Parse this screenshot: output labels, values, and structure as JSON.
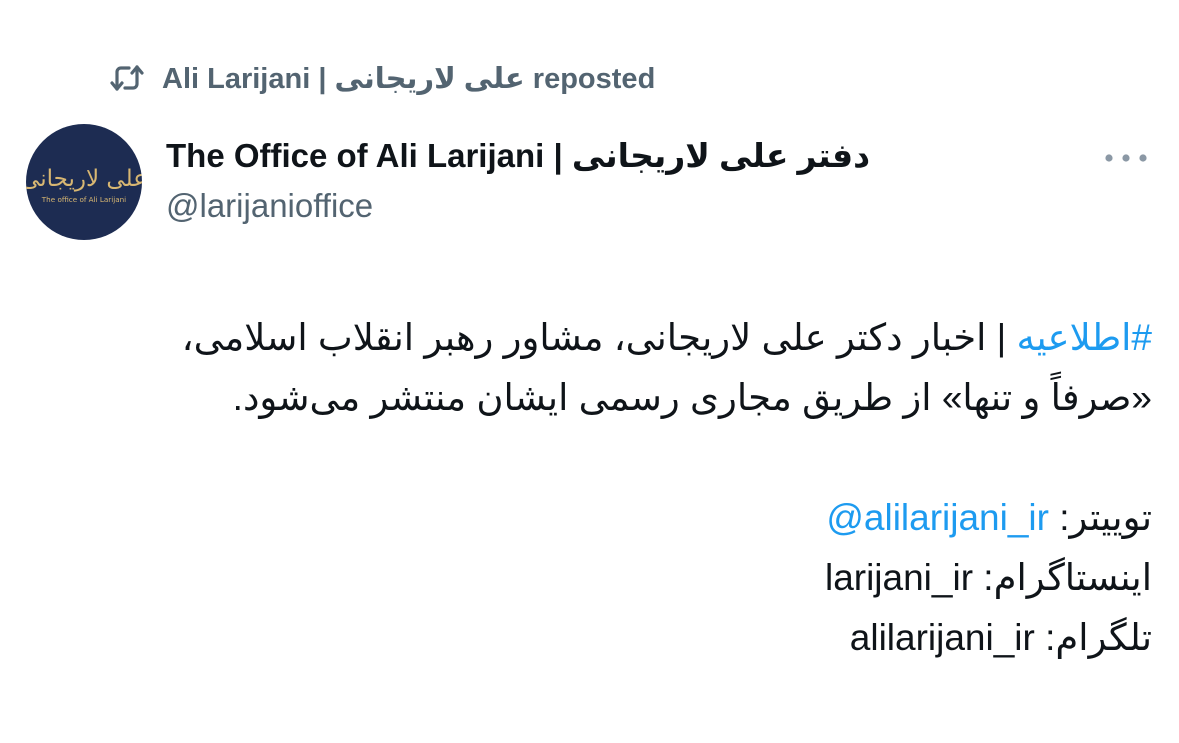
{
  "repost": {
    "icon": "repost-icon",
    "text": "Ali Larijani | علی لاریجانی reposted"
  },
  "author": {
    "avatar_icon": "avatar",
    "avatar_logo_text": "علی لاریجانی",
    "avatar_logo_subtext": "The office of Ali Larijani",
    "name": "The Office of Ali Larijani | دفتر علی لاریجانی",
    "handle": "@larijanioffice"
  },
  "menu": {
    "icon": "more-horizontal-icon"
  },
  "tweet": {
    "hashtag": "#اطلاعیه",
    "line1_rest": " | اخبار دکتر علی لاریجانی، مشاور رهبر انقلاب اسلامی،",
    "line2": "«صرفاً و تنها» از طریق مجاری رسمی ایشان منتشر می‌شود.",
    "twitter_label": "توییتر: ",
    "twitter_handle": "@alilarijani_ir",
    "instagram_label": "اینستاگرام: ",
    "instagram_handle": "larijani_ir",
    "telegram_label": "تلگرام: ",
    "telegram_handle": "alilarijani_ir"
  },
  "colors": {
    "link": "#1d9bf0",
    "secondary_text": "#536471",
    "primary_text": "#0f1419",
    "avatar_bg": "#1d2c52",
    "avatar_logo": "#d8b772"
  }
}
